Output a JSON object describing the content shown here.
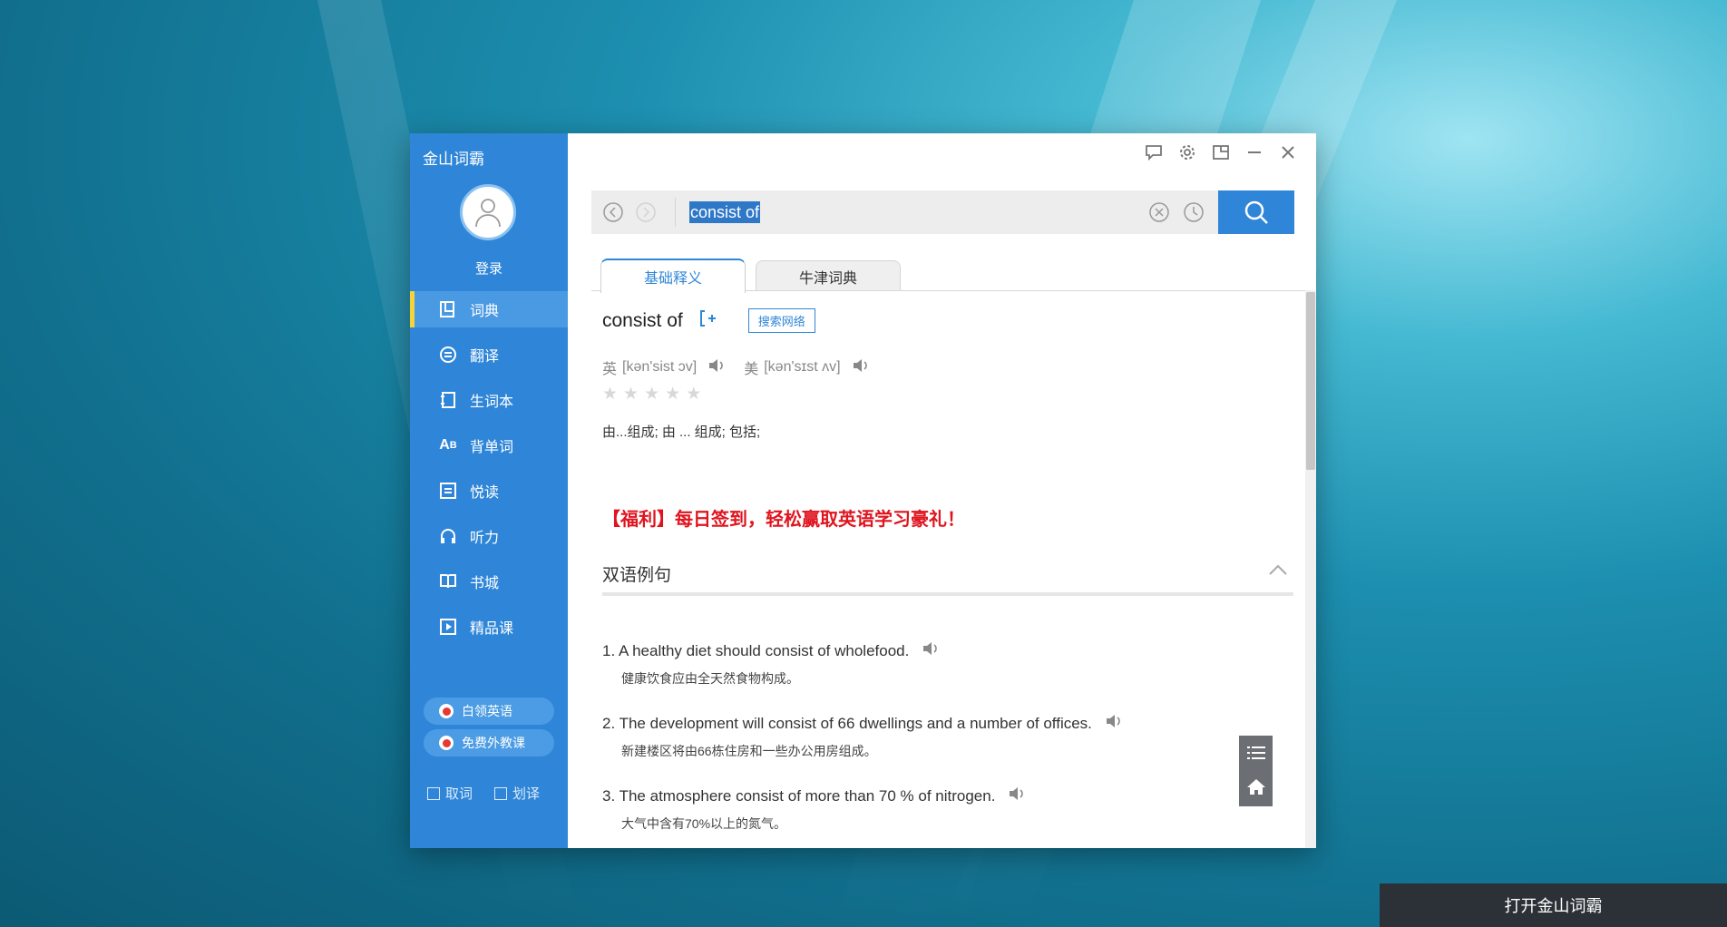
{
  "app": {
    "title": "金山词霸"
  },
  "sidebar": {
    "login": "登录",
    "items": [
      {
        "label": "词典",
        "icon": "dictionary-icon",
        "active": true
      },
      {
        "label": "翻译",
        "icon": "translate-icon"
      },
      {
        "label": "生词本",
        "icon": "wordbook-icon"
      },
      {
        "label": "背单词",
        "icon": "memorize-icon"
      },
      {
        "label": "悦读",
        "icon": "reading-icon"
      },
      {
        "label": "听力",
        "icon": "headphones-icon"
      },
      {
        "label": "书城",
        "icon": "book-icon"
      },
      {
        "label": "精品课",
        "icon": "play-icon"
      }
    ],
    "promos": [
      {
        "label": "白领英语"
      },
      {
        "label": "免费外教课"
      }
    ],
    "options": [
      {
        "label": "取词"
      },
      {
        "label": "划译"
      }
    ]
  },
  "search": {
    "value": "consist of"
  },
  "tabs": [
    {
      "label": "基础释义",
      "active": true
    },
    {
      "label": "牛津词典"
    }
  ],
  "entry": {
    "word": "consist of",
    "web_search": "搜索网络",
    "uk_label": "英",
    "uk_phonetic": "[kən'sist ɔv]",
    "us_label": "美",
    "us_phonetic": "[kən'sɪst ʌv]",
    "stars": 0,
    "definition": "由...组成; 由 ... 组成; 包括;",
    "promo": "【福利】每日签到，轻松赢取英语学习豪礼！"
  },
  "examples": {
    "heading": "双语例句",
    "items": [
      {
        "en": "1. A healthy diet should consist of wholefood.",
        "zh": "健康饮食应由全天然食物构成。"
      },
      {
        "en": "2. The development will consist of 66 dwellings and a number of offices.",
        "zh": "新建楼区将由66栋住房和一些办公用房组成。"
      },
      {
        "en": "3. The atmosphere consist of more than 70 % of nitrogen.",
        "zh": "大气中含有70%以上的氮气。"
      }
    ]
  },
  "taskbar": {
    "open_label": "打开金山词霸"
  },
  "colors": {
    "accent": "#2f86d8",
    "promo": "#e0141e"
  }
}
